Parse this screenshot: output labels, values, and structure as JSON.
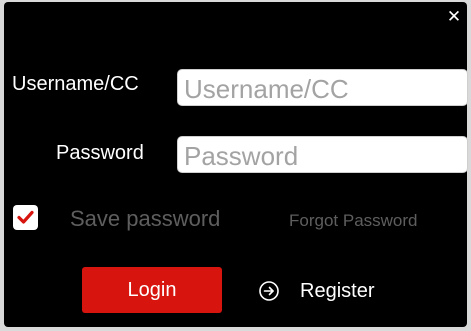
{
  "dialog": {
    "close_icon": "close-icon",
    "close_glyph": "✕"
  },
  "form": {
    "username": {
      "label": "Username/CC",
      "placeholder": "Username/CC",
      "value": ""
    },
    "password": {
      "label": "Password",
      "placeholder": "Password",
      "value": ""
    },
    "save_password": {
      "label": "Save password",
      "checked": true,
      "icon": "checkmark-icon"
    },
    "forgot_password_label": "Forgot Password"
  },
  "actions": {
    "login_label": "Login",
    "register_label": "Register",
    "register_icon": "arrow-right-circle-icon"
  },
  "colors": {
    "background": "#000000",
    "accent": "#d7140e",
    "muted_text": "#5e5e5e",
    "text": "#ffffff"
  }
}
